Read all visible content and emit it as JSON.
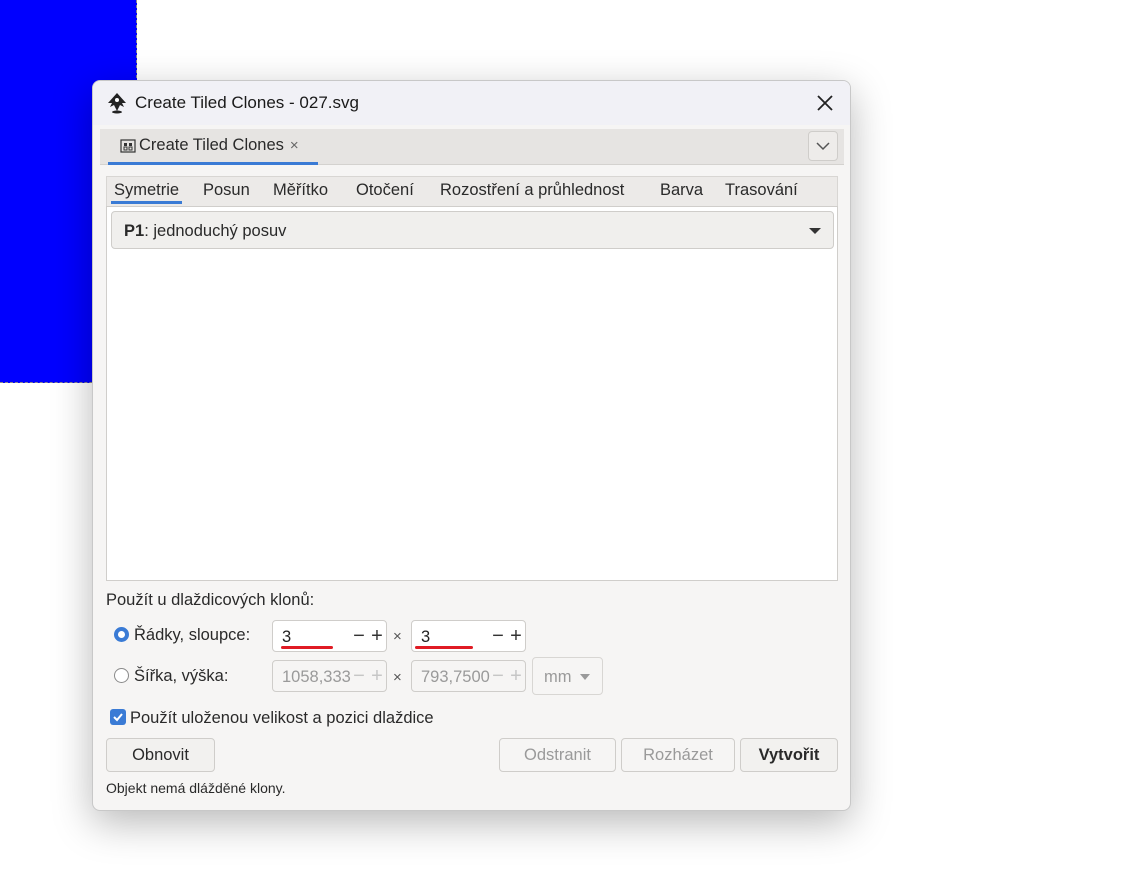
{
  "window": {
    "title": "Create Tiled Clones - 027.svg"
  },
  "notebook": {
    "tab_label": "Create Tiled Clones",
    "tab_close": "×"
  },
  "tabs": [
    "Symetrie",
    "Posun",
    "Měřítko",
    "Otočení",
    "Rozostření a průhlednost",
    "Barva",
    "Trasování"
  ],
  "symmetry": {
    "code": "P1",
    "description": ": jednoduchý posuv"
  },
  "apply": {
    "label": "Použít u dlaždicových klonů:",
    "rows_cols_label": "Řádky, sloupce:",
    "rows_value": "3",
    "cols_value": "3",
    "times": "×",
    "width_height_label": "Šířka, výška:",
    "width_value": "1058,333",
    "height_value": "793,7500",
    "unit": "mm",
    "selected": "rows_cols"
  },
  "checkbox": {
    "label": "Použít uloženou velikost a pozici dlaždice",
    "checked": true
  },
  "buttons": {
    "reset": "Obnovit",
    "remove": "Odstranit",
    "unclump": "Rozházet",
    "create": "Vytvořit"
  },
  "status": "Objekt nemá dlážděné klony.",
  "colors": {
    "accent": "#3a7bd5",
    "canvas_object": "#0000ff",
    "highlight_underline": "#e01b24"
  }
}
